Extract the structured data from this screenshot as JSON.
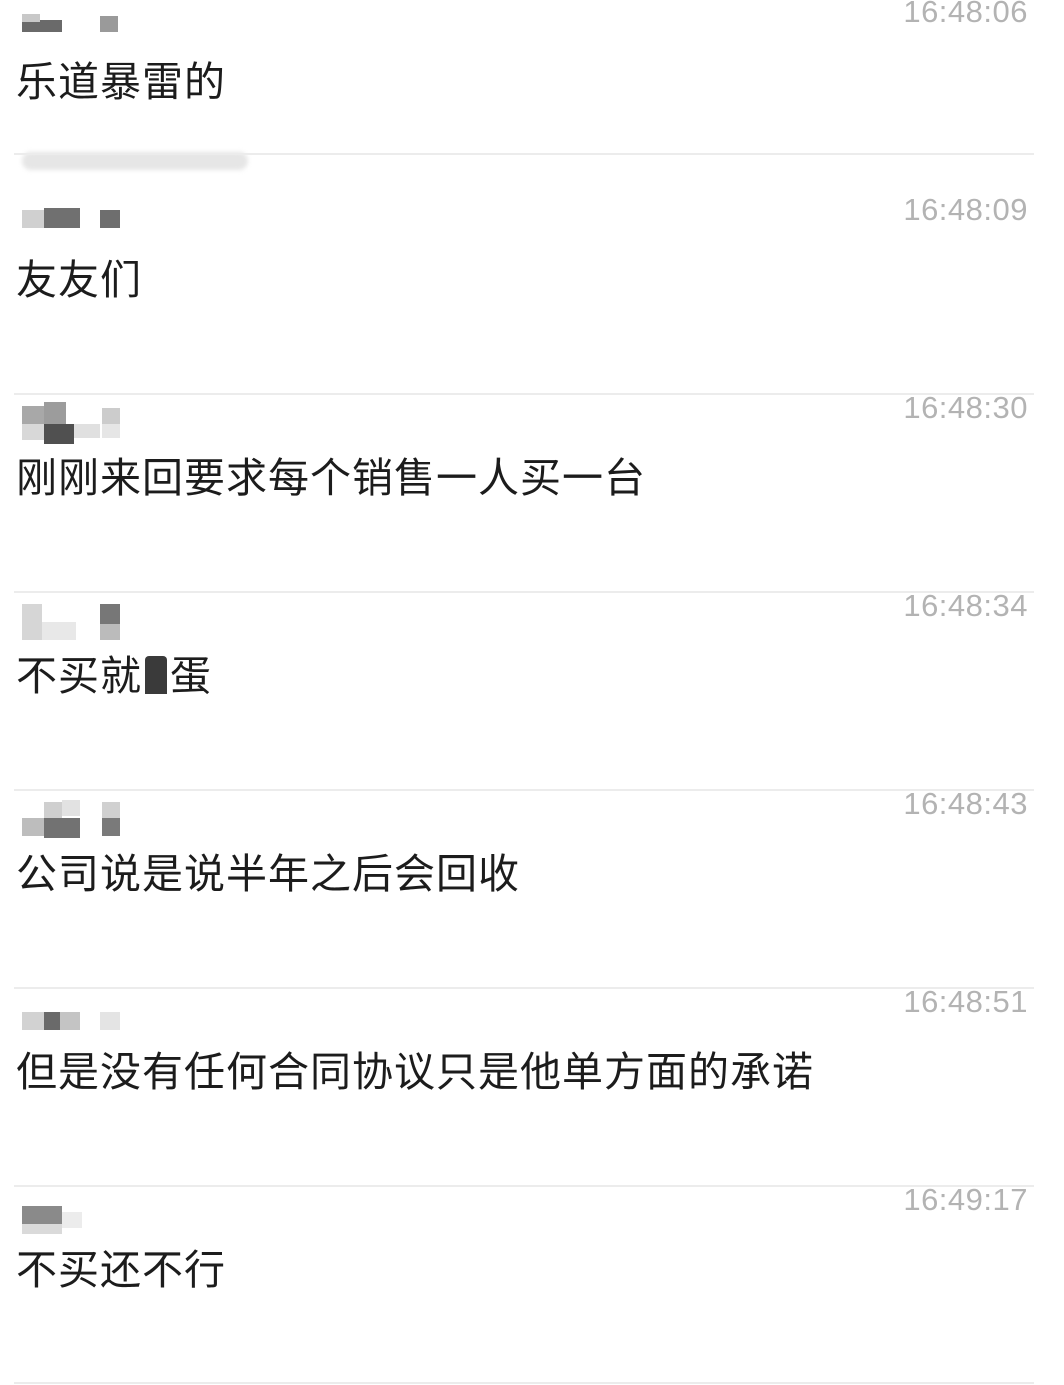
{
  "chat": {
    "messages": [
      {
        "time": "16:48:06",
        "text_parts": [
          "乐道暴雷的"
        ]
      },
      {
        "time": "16:48:09",
        "text_parts": [
          "友友们"
        ]
      },
      {
        "time": "16:48:30",
        "text_parts": [
          "刚刚来回要求每个销售一人买一台"
        ]
      },
      {
        "time": "16:48:34",
        "text_parts": [
          "不买就",
          "蛋"
        ],
        "censored_char": true
      },
      {
        "time": "16:48:43",
        "text_parts": [
          "公司说是说半年之后会回收"
        ]
      },
      {
        "time": "16:48:51",
        "text_parts": [
          "但是没有任何合同协议只是他单方面的承诺"
        ]
      },
      {
        "time": "16:49:17",
        "text_parts": [
          "不买还不行"
        ]
      }
    ]
  },
  "colors": {
    "timestamp": "#b3b3b3",
    "text": "#1c1c1c",
    "divider": "#ececec",
    "mosaic_dark": "#555555",
    "mosaic_light": "#cfcfcf"
  }
}
